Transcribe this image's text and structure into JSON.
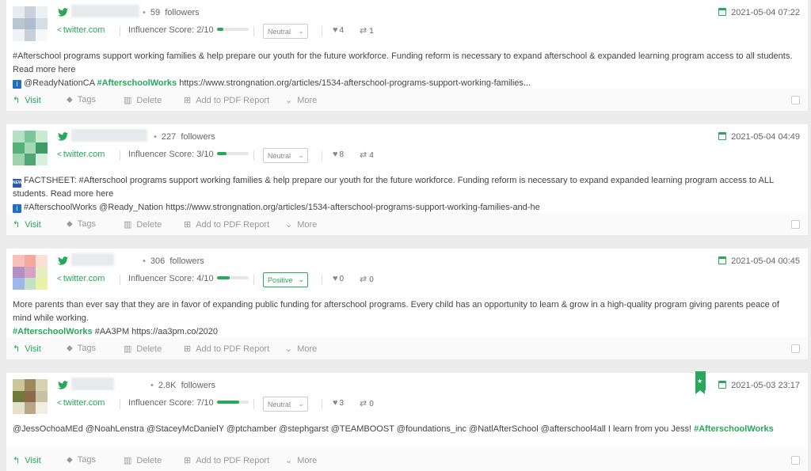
{
  "actions": {
    "visit": "Visit",
    "tags": "Tags",
    "delete": "Delete",
    "pdf": "Add to PDF Report",
    "more": "More"
  },
  "colors": {
    "accent": "#27a85a"
  },
  "posts": [
    {
      "followers": "59",
      "followers_label": "followers",
      "date": "2021-05-04 07:22",
      "site": "twitter.com",
      "score_label": "Influencer Score: 2/10",
      "score": 0.2,
      "sentiment": "Neutral",
      "likes": "4",
      "retweets": "1",
      "text_pre": "#Afterschool programs support working families & help prepare our youth for the future workforce. Funding reform is necessary to expand afterschool & expanded learning program access to all students. Read more here",
      "emoji": "i",
      "mention": "@ReadyNationCA",
      "hashtag": "#AfterschoolWorks",
      "text_post": "https://www.strongnation.org/articles/1534-afterschool-programs-support-working-families..."
    },
    {
      "followers": "227",
      "followers_label": "followers",
      "date": "2021-05-04 04:49",
      "site": "twitter.com",
      "score_label": "Influencer Score: 3/10",
      "score": 0.3,
      "sentiment": "Neutral",
      "likes": "8",
      "retweets": "4",
      "text": "FACTSHEET: #Afterschool programs support working families & help prepare our youth for the future workforce. Funding reform is necessary to expand expanded learning program access to ALL students. Read more here",
      "text2": "#AfterschoolWorks @Ready_Nation https://www.strongnation.org/articles/1534-afterschool-programs-support-working-families-and-he"
    },
    {
      "followers": "306",
      "followers_label": "followers",
      "date": "2021-05-04 00:45",
      "site": "twitter.com",
      "score_label": "Influencer Score: 4/10",
      "score": 0.4,
      "sentiment": "Positive",
      "likes": "0",
      "retweets": "0",
      "text": "More parents than ever say that they are in favor of expanding public funding for afterschool programs. Every child has an opportunity to learn & grow in a high-quality program giving parents peace of mind while working.",
      "hashtag": "#AfterschoolWorks",
      "text_post": "#AA3PM https://aa3pm.co/2020"
    },
    {
      "followers": "2.8K",
      "followers_label": "followers",
      "date": "2021-05-03 23:17",
      "site": "twitter.com",
      "score_label": "Influencer Score: 7/10",
      "score": 0.7,
      "sentiment": "Neutral",
      "likes": "3",
      "retweets": "0",
      "text": "@JessOchoaMEd @NoahLenstra @StaceyMcDanielY @ptchamber @stephgarst @TEAMBOOST @foundations_inc @NatlAfterSchool @afterschool4all I learn from you Jess!",
      "hashtag": "#AfterschoolWorks"
    }
  ]
}
